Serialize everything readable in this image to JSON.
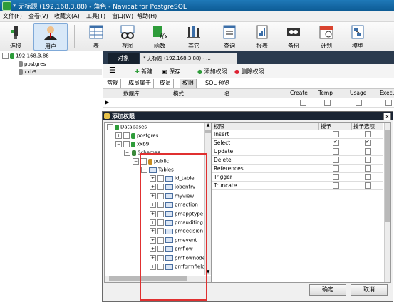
{
  "window": {
    "title": "* 无标题 (192.168.3.88) - 角色 - Navicat for PostgreSQL"
  },
  "menu": [
    "文件(F)",
    "查看(V)",
    "收藏夹(A)",
    "工具(T)",
    "窗口(W)",
    "帮助(H)"
  ],
  "toolbar": [
    {
      "label": "连接",
      "icon": "connection-icon"
    },
    {
      "label": "用户",
      "icon": "user-icon",
      "selected": true
    },
    {
      "label": "表",
      "icon": "table-icon"
    },
    {
      "label": "视图",
      "icon": "view-icon"
    },
    {
      "label": "函数",
      "icon": "function-icon"
    },
    {
      "label": "其它",
      "icon": "others-icon"
    },
    {
      "label": "查询",
      "icon": "query-icon"
    },
    {
      "label": "报表",
      "icon": "report-icon"
    },
    {
      "label": "备份",
      "icon": "backup-icon"
    },
    {
      "label": "计划",
      "icon": "schedule-icon"
    },
    {
      "label": "模型",
      "icon": "model-icon"
    }
  ],
  "left_tree": {
    "server": "192.168.3.88",
    "items": [
      "postgres",
      "xxb9"
    ]
  },
  "tabs": {
    "objects": "对象",
    "role": "* 无标题 (192.168.3.88) - ..."
  },
  "obj_toolbar": {
    "new": "新建",
    "save": "保存",
    "add_privilege": "添加权限",
    "delete_privilege": "删除权限"
  },
  "subtabs": [
    "常规",
    "成员属于",
    "成员",
    "权限",
    "SQL 预览"
  ],
  "grid_header": [
    "数据库",
    "模式",
    "名",
    "Create",
    "Temp",
    "Usage",
    "Execu"
  ],
  "dialog": {
    "title": "添加权限",
    "tree": {
      "databases": "Databases",
      "postgres": "postgres",
      "xxb9": "xxb9",
      "schemas": "Schemas",
      "public": "public",
      "tables": "Tables",
      "table_items": [
        "id_table",
        "jobentry",
        "myview",
        "pmaction",
        "pmapptype",
        "pmauditing",
        "pmdecision",
        "pmevent",
        "pmflow",
        "pmflownode",
        "pmformfield"
      ]
    },
    "grid": {
      "headers": [
        "权限",
        "授予",
        "授予选项"
      ],
      "rows": [
        {
          "name": "Insert",
          "grant": false,
          "option": false
        },
        {
          "name": "Select",
          "grant": true,
          "option": true
        },
        {
          "name": "Update",
          "grant": false,
          "option": false
        },
        {
          "name": "Delete",
          "grant": false,
          "option": false
        },
        {
          "name": "References",
          "grant": false,
          "option": false
        },
        {
          "name": "Trigger",
          "grant": false,
          "option": false
        },
        {
          "name": "Truncate",
          "grant": false,
          "option": false
        }
      ]
    },
    "ok": "确定",
    "cancel": "取消"
  },
  "colors": {
    "titlebar": "#0c5a93",
    "dialog_title": "#1a2433",
    "highlight": "#e03030"
  }
}
